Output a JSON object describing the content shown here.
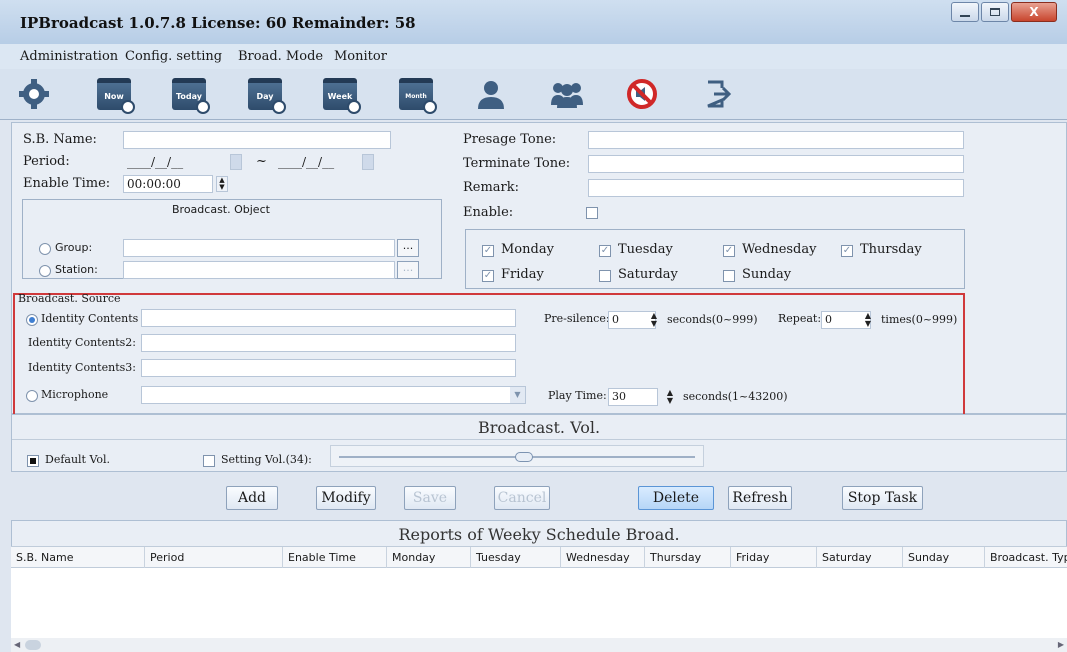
{
  "window": {
    "title": "IPBroadcast 1.0.7.8 License: 60 Remainder: 58",
    "close_glyph": "X"
  },
  "menu": [
    "Administration",
    "Config. setting",
    "Broad. Mode",
    "Monitor"
  ],
  "toolbar": {
    "icons": [
      "gear-icon",
      "now-calendar-icon",
      "today-calendar-icon",
      "day-calendar-icon",
      "week-calendar-icon",
      "month-calendar-icon",
      "user-icon",
      "users-group-icon",
      "mute-icon",
      "exit-icon"
    ],
    "cal_labels": [
      "Now",
      "Today",
      "Day",
      "Week",
      "Month"
    ]
  },
  "form": {
    "sb_name_label": "S.B. Name:",
    "period_label": "Period:",
    "period_from": "____/__/__",
    "period_sep": "~",
    "period_to": "____/__/__",
    "enable_time_label": "Enable Time:",
    "enable_time_value": "00:00:00",
    "presage_tone_label": "Presage Tone:",
    "terminate_tone_label": "Terminate Tone:",
    "remark_label": "Remark:",
    "enable_label": "Enable:"
  },
  "broadcast_object": {
    "title": "Broadcast. Object",
    "group_label": "Group:",
    "station_label": "Station:",
    "browse_label": "..."
  },
  "days": {
    "row1": [
      "Monday",
      "Tuesday",
      "Wednesday",
      "Thursday"
    ],
    "row2": [
      "Friday",
      "Saturday",
      "Sunday"
    ],
    "checked": [
      "Monday",
      "Tuesday",
      "Wednesday",
      "Thursday",
      "Friday"
    ]
  },
  "source": {
    "title": "Broadcast. Source",
    "identity_contents": "Identity Contents",
    "identity_contents2": "Identity Contents2:",
    "identity_contents3": "Identity Contents3:",
    "microphone": "Microphone",
    "pre_silence_label": "Pre-silence:",
    "pre_silence_value": "0",
    "pre_silence_unit": "seconds(0~999)",
    "repeat_label": "Repeat:",
    "repeat_value": "0",
    "repeat_unit": "times(0~999)",
    "play_time_label": "Play Time:",
    "play_time_value": "30",
    "play_time_unit": "seconds(1~43200)"
  },
  "volume": {
    "title": "Broadcast. Vol.",
    "default_label": "Default Vol.",
    "setting_label": "Setting Vol.(34):",
    "level": 34
  },
  "buttons": {
    "add": "Add",
    "modify": "Modify",
    "save": "Save",
    "cancel": "Cancel",
    "delete": "Delete",
    "refresh": "Refresh",
    "stop_task": "Stop Task"
  },
  "report": {
    "title": "Reports of Weeky Schedule Broad.",
    "columns": [
      "S.B. Name",
      "Period",
      "Enable Time",
      "Monday",
      "Tuesday",
      "Wednesday",
      "Thursday",
      "Friday",
      "Saturday",
      "Sunday",
      "Broadcast. Typ"
    ]
  }
}
